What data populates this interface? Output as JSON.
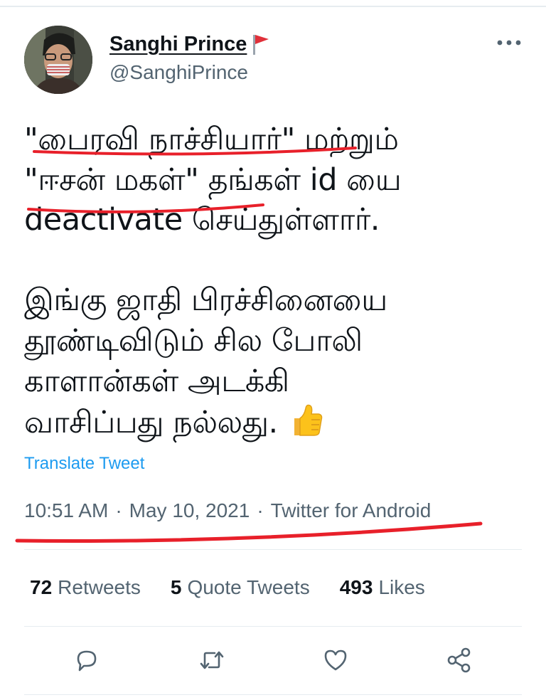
{
  "tweet": {
    "author": {
      "display_name": "Sanghi Prince",
      "handle": "@SanghiPrince",
      "badge_icon": "red-flag-icon"
    },
    "menu_icon": "more-dots-icon",
    "text": "\"பைரவி நாச்சியார்\" மற்றும்\n\"ஈசன் மகள்\" தங்கள் id யை\ndeactivate செய்துள்ளார்.\n\nஇங்கு ஜாதி பிரச்சினையை\nதூண்டிவிடும் சில போலி\nகாளான்கள் அடக்கி\nவாசிப்பது நல்லது.",
    "emoji": "thumbs-up-emoji",
    "translate_label": "Translate Tweet",
    "time": "10:51 AM",
    "separator": "·",
    "date": "May 10, 2021",
    "source": "Twitter for Android",
    "stats": [
      {
        "count": "72",
        "label": "Retweets"
      },
      {
        "count": "5",
        "label": "Quote Tweets"
      },
      {
        "count": "493",
        "label": "Likes"
      }
    ],
    "actions": [
      "reply-icon",
      "retweet-icon",
      "like-icon",
      "share-icon"
    ]
  },
  "colors": {
    "text": "#0f1419",
    "muted": "#536471",
    "link": "#1d9bf0",
    "annotation": "#e8202a",
    "divider": "#e6ecf0"
  }
}
